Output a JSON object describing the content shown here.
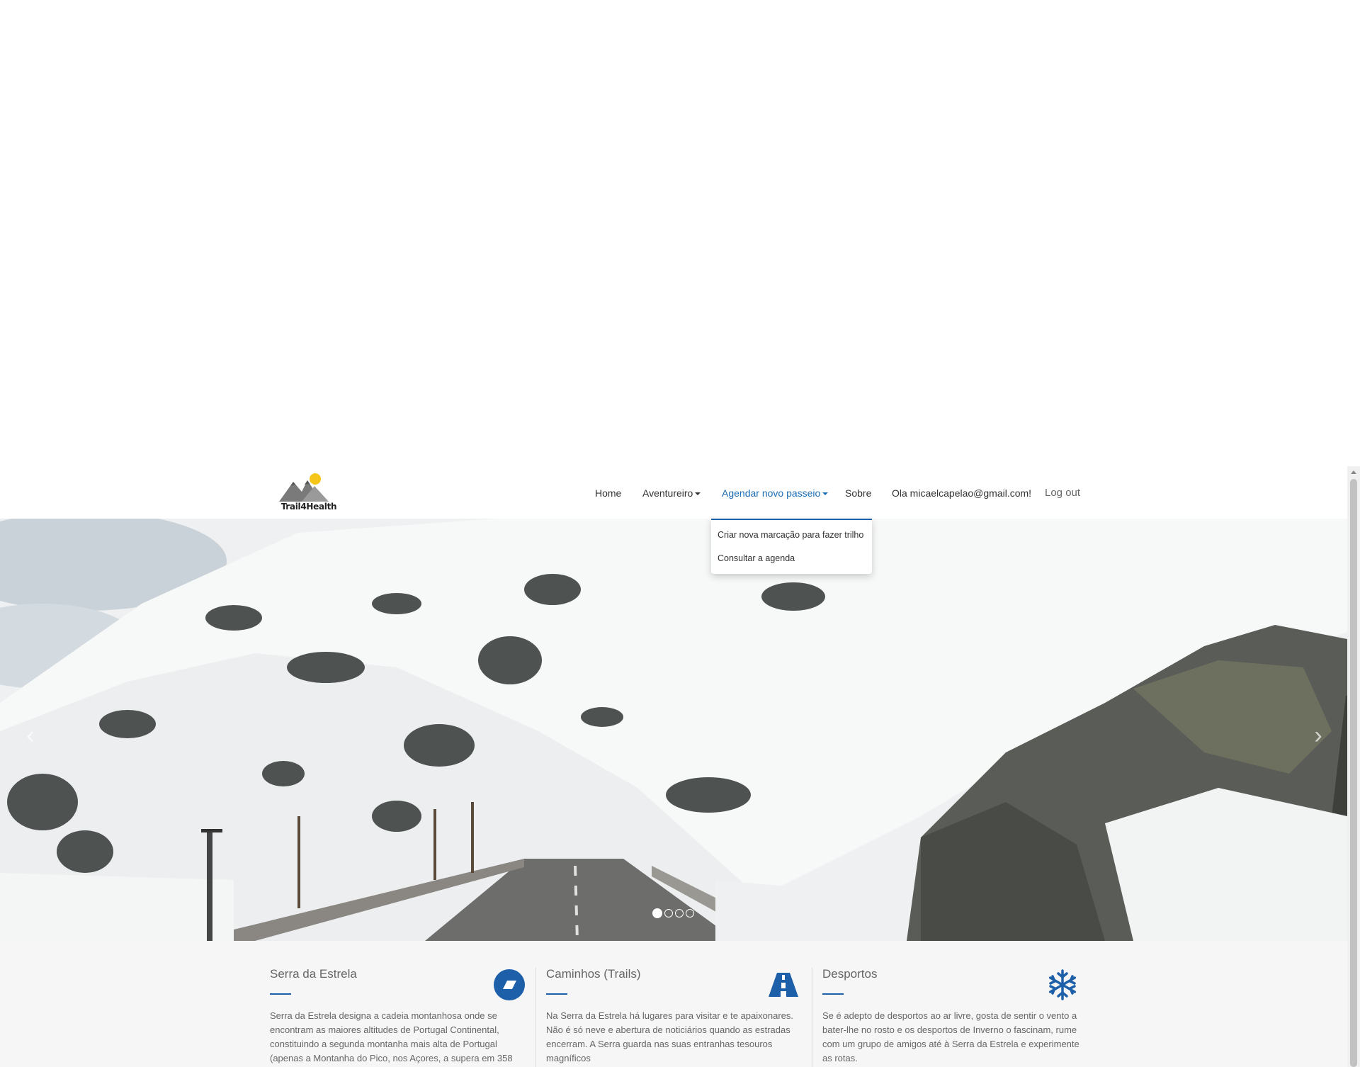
{
  "brand": {
    "logo_text": "Trail4Health",
    "accent_color": "#1d5fa8"
  },
  "nav": {
    "home": "Home",
    "aventureiro": "Aventureiro",
    "agendar": "Agendar novo passeio",
    "sobre": "Sobre",
    "greeting": "Ola micaelcapelao@gmail.com!",
    "logout": "Log out"
  },
  "dropdown": {
    "item1": "Criar nova marcação para fazer trilho",
    "item2": "Consultar a agenda"
  },
  "carousel": {
    "slide_count": 4,
    "active_index": 0
  },
  "features": [
    {
      "title": "Serra da Estrela",
      "icon": "shape-badge-icon",
      "text": "Serra da Estrela designa a cadeia montanhosa onde se encontram as maiores altitudes de Portugal Continental, constituindo a segunda montanha mais alta de Portugal (apenas a Montanha do Pico, nos Açores, a supera em 358"
    },
    {
      "title": "Caminhos (Trails)",
      "icon": "road-icon",
      "text": "Na Serra da Estrela há lugares para visitar e te apaixonares. Não é só neve e abertura de noticiários quando as estradas encerram. A Serra guarda nas suas entranhas tesouros magníficos"
    },
    {
      "title": "Desportos",
      "icon": "snowflake-icon",
      "text": "Se é adepto de desportos ao ar livre, gosta de sentir o vento a bater-lhe no rosto e os desportos de Inverno o fascinam, rume com um grupo de amigos até à Serra da Estrela e experimente as rotas."
    }
  ]
}
